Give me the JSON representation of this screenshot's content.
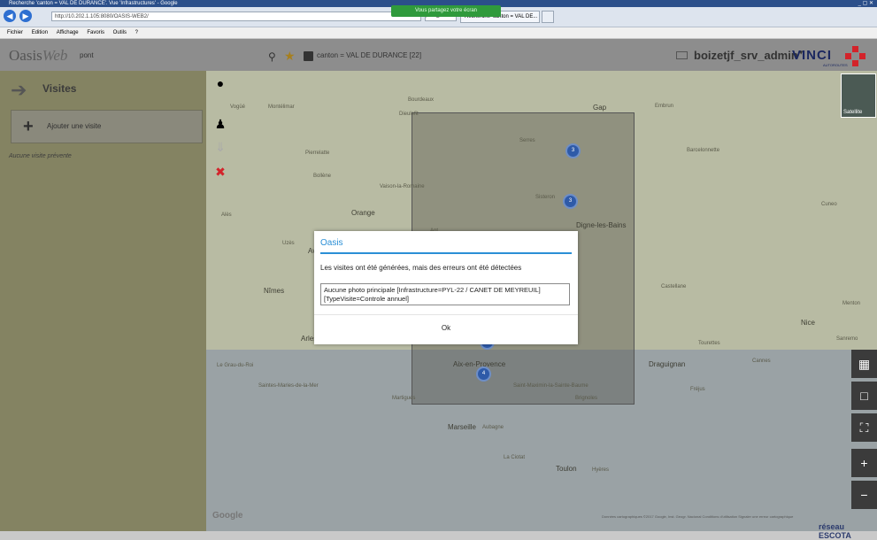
{
  "browser": {
    "title": "Recherche 'canton = VAL DE DURANCE'. Vue 'Infrastructures' - Google",
    "share_banner": "Vous partagez votre écran",
    "url": "http://10.202.1.105:8080/OASIS-WEB2/",
    "tab_label": "Recherche 'canton = VAL DE...",
    "menu": [
      "Fichier",
      "Edition",
      "Affichage",
      "Favoris",
      "Outils",
      "?"
    ]
  },
  "header": {
    "app_name": "Oasis",
    "app_name_suffix": "Web",
    "search_value": "pont",
    "filter_label": "canton = VAL DE DURANCE [22]",
    "username": "boizetjf_srv_admin",
    "brand": "VINCI",
    "brand_sub": "AUTOROUTES"
  },
  "sidebar": {
    "title": "Visites",
    "add_button": "Ajouter une visite",
    "empty_text": "Aucune visite prévente"
  },
  "map": {
    "cities": [
      {
        "name": "Montélimar"
      },
      {
        "name": "Dieulefit"
      },
      {
        "name": "Vogüé"
      },
      {
        "name": "Bourdeaux"
      },
      {
        "name": "Serres"
      },
      {
        "name": "Gap"
      },
      {
        "name": "Embrun"
      },
      {
        "name": "Barcelonnette"
      },
      {
        "name": "Bollène"
      },
      {
        "name": "Pierrelatte"
      },
      {
        "name": "Vaison-la-Romaine"
      },
      {
        "name": "Orange"
      },
      {
        "name": "Uzès"
      },
      {
        "name": "Alès"
      },
      {
        "name": "Nîmes"
      },
      {
        "name": "Avignon"
      },
      {
        "name": "Digne-les-Bains"
      },
      {
        "name": "Castellane"
      },
      {
        "name": "Sisteron"
      },
      {
        "name": "Apt"
      },
      {
        "name": "Arles"
      },
      {
        "name": "Aix-en-Provence"
      },
      {
        "name": "Marseille"
      },
      {
        "name": "Aubagne"
      },
      {
        "name": "Toulon"
      },
      {
        "name": "Hyères"
      },
      {
        "name": "Nice"
      },
      {
        "name": "Cannes"
      },
      {
        "name": "Draguignan"
      },
      {
        "name": "Fréjus"
      },
      {
        "name": "Menton"
      },
      {
        "name": "Brignoles"
      },
      {
        "name": "Martigues"
      },
      {
        "name": "La Ciotat"
      },
      {
        "name": "Saint-Maximin-la-Sainte-Baume"
      },
      {
        "name": "Saintes-Maries-de-la-Mer"
      },
      {
        "name": "Le Grau-du-Roi"
      },
      {
        "name": "Cuneo"
      },
      {
        "name": "Sanremo"
      },
      {
        "name": "Tourettes"
      }
    ],
    "clusters": [
      "3",
      "3",
      "4",
      "4"
    ],
    "satellite_label": "Satellite",
    "google": "Google",
    "attribution": "Données cartographiques ©2017 Google, Inst. Geogr. Nacional   Conditions d'utilisation   Signaler une erreur cartographique",
    "footer_brand": "réseau ESCOTA"
  },
  "dialog": {
    "title": "Oasis",
    "message": "Les visites ont été générées, mais des erreurs ont été détectées",
    "detail": "Aucune photo principale [Infrastructure=PYL-22 / CANET DE MEYREUIL] [TypeVisite=Controle annuel]",
    "ok_label": "Ok"
  }
}
